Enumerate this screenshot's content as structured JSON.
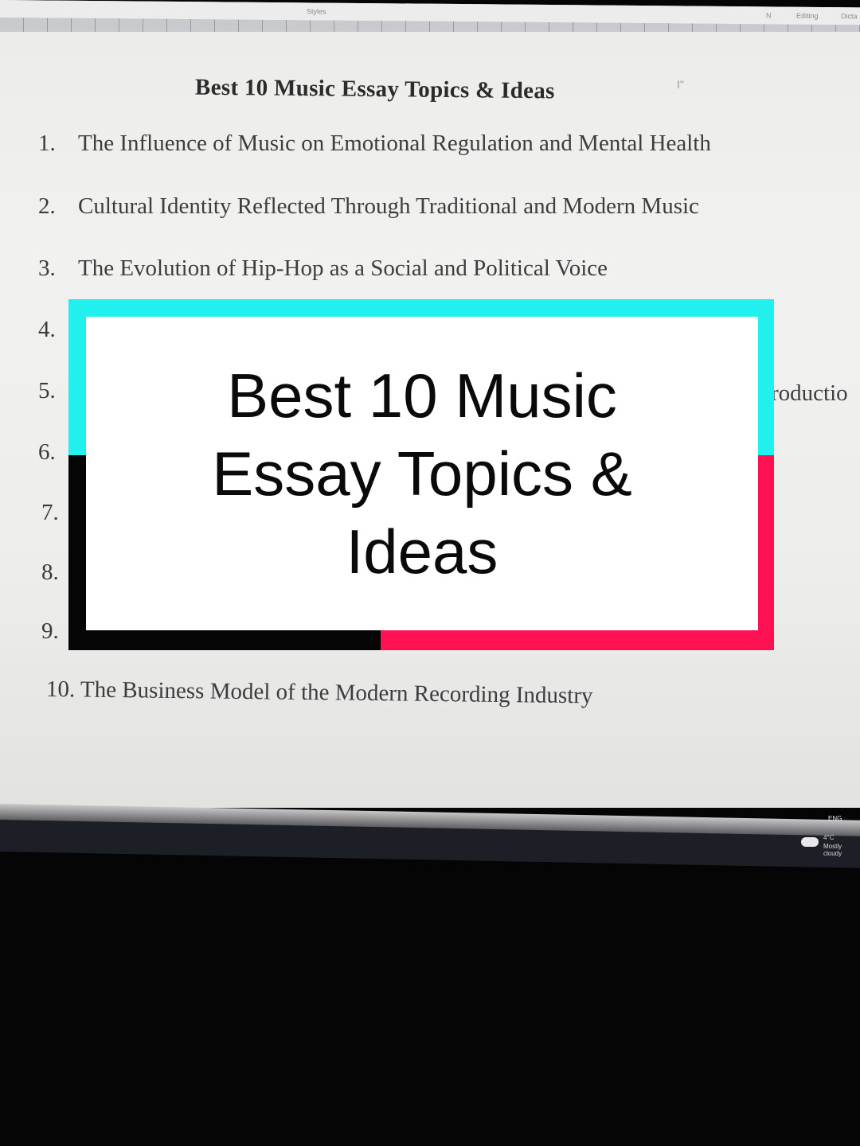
{
  "window": {
    "ribbon_labels": [
      "Styles",
      "N",
      "Editing",
      "Dicta"
    ]
  },
  "document": {
    "title": "Best 10 Music Essay Topics & Ideas",
    "cursor_mark": "I\"",
    "items": [
      {
        "num": "1.",
        "text": "The Influence of Music on Emotional Regulation and Mental Health"
      },
      {
        "num": "2.",
        "text": "Cultural Identity Reflected Through Traditional and Modern Music"
      },
      {
        "num": "3.",
        "text": "The Evolution of Hip-Hop as a Social and Political Voice"
      },
      {
        "num": "4.",
        "text": ""
      },
      {
        "num": "5.",
        "text": ""
      },
      {
        "num": "6.",
        "text": ""
      },
      {
        "num": "7.",
        "text": ""
      },
      {
        "num": "8.",
        "text": ""
      },
      {
        "num": "9.",
        "text": ""
      }
    ],
    "item5_fragment": "roductio",
    "item10": {
      "num": "10.",
      "text": "The Business Model of the Modern Recording Industry"
    }
  },
  "overlay": {
    "lines": [
      "Best 10 Music",
      "Essay Topics &",
      "Ideas"
    ],
    "colors": {
      "cyan": "#21f0ee",
      "pink": "#fe1153",
      "black": "#050505",
      "card": "#ffffff"
    }
  },
  "taskbar": {
    "weather_temp": "4°C",
    "weather_status": "Mostly cloudy",
    "tray_label": "ENG"
  }
}
